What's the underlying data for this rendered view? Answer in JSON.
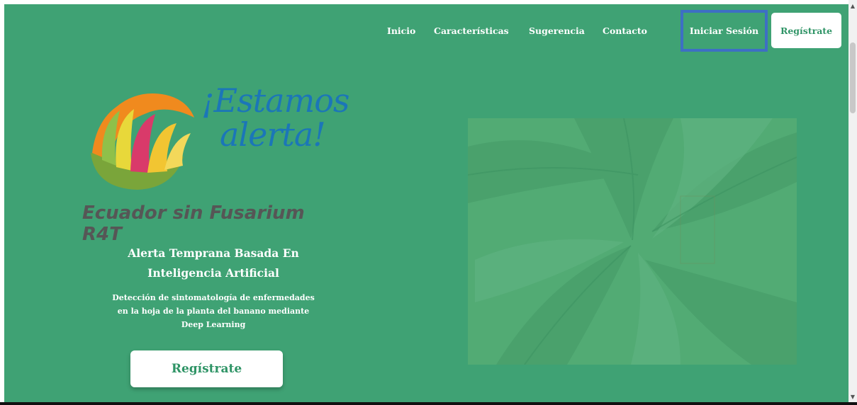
{
  "nav": {
    "links": [
      "Inicio",
      "Características",
      "Sugerencia",
      "Contacto"
    ],
    "login_label": "Iniciar Sesión",
    "register_label": "Regístrate"
  },
  "logo": {
    "headline_line1": "¡Estamos",
    "headline_line2": "alerta!",
    "subtitle": "Ecuador sin Fusarium R4T"
  },
  "hero": {
    "title_line1": "Alerta Temprana Basada En",
    "title_line2": "Inteligencia Artificial",
    "desc_line1": "Detección de sintomatología de enfermedades",
    "desc_line2": "en la hoja de la planta del banano mediante",
    "desc_line3": "Deep Learning",
    "cta_label": "Regístrate"
  },
  "colors": {
    "background": "#3fa274",
    "accent_green": "#2f9466",
    "login_highlight": "#3d6fc4",
    "logo_blue": "#1b76b8"
  }
}
